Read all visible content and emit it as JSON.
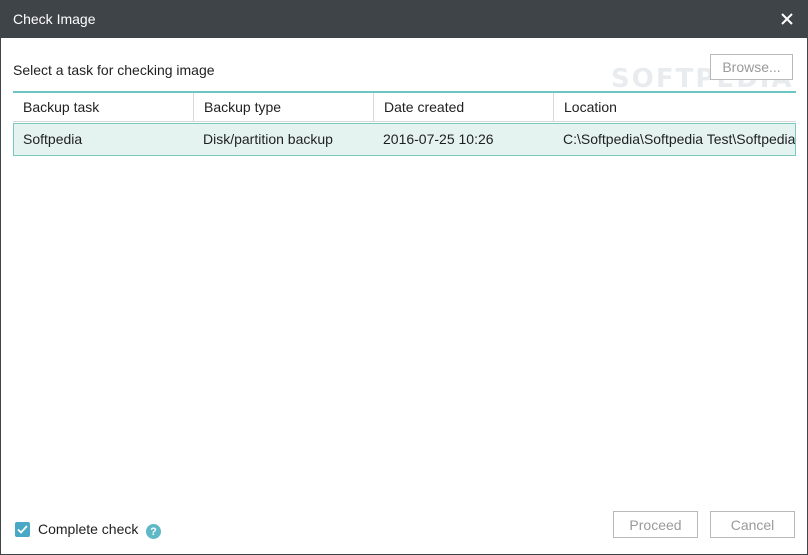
{
  "window": {
    "title": "Check Image"
  },
  "instruction": "Select a task for checking image",
  "watermark": "SOFTPEDIA",
  "browse_label": "Browse...",
  "table": {
    "columns": [
      "Backup task",
      "Backup type",
      "Date created",
      "Location"
    ],
    "rows": [
      {
        "task": "Softpedia",
        "type": "Disk/partition backup",
        "date": "2016-07-25 10:26",
        "location": "C:\\Softpedia\\Softpedia Test\\Softpedia"
      }
    ]
  },
  "footer": {
    "complete_check_label": "Complete check",
    "complete_check_checked": true,
    "help_glyph": "?",
    "proceed_label": "Proceed",
    "cancel_label": "Cancel"
  },
  "colors": {
    "titlebar": "#3f4449",
    "accent": "#6ec6c2",
    "selected_row": "#e5f3f0",
    "checkbox": "#4aa8c7"
  }
}
